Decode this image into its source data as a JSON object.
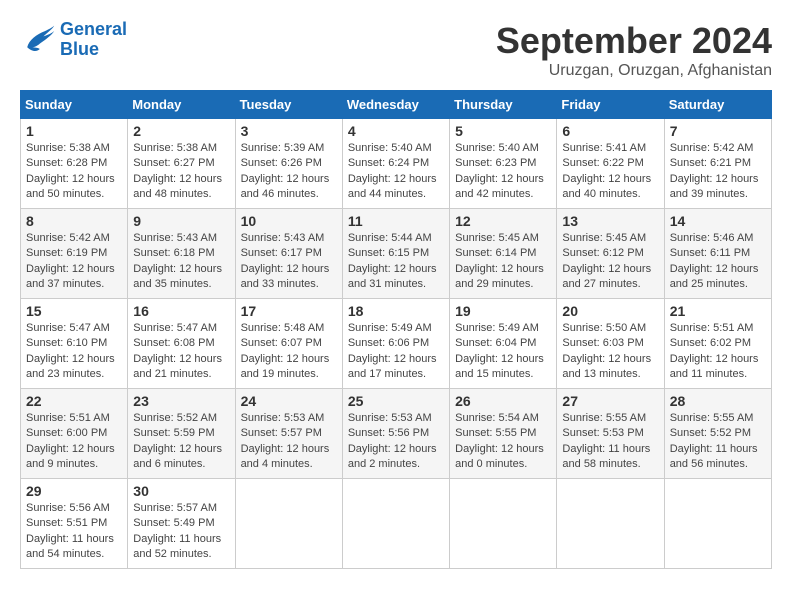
{
  "header": {
    "logo_line1": "General",
    "logo_line2": "Blue",
    "month": "September 2024",
    "location": "Uruzgan, Oruzgan, Afghanistan"
  },
  "weekdays": [
    "Sunday",
    "Monday",
    "Tuesday",
    "Wednesday",
    "Thursday",
    "Friday",
    "Saturday"
  ],
  "weeks": [
    [
      {
        "day": "1",
        "sunrise": "5:38 AM",
        "sunset": "6:28 PM",
        "daylight": "12 hours and 50 minutes."
      },
      {
        "day": "2",
        "sunrise": "5:38 AM",
        "sunset": "6:27 PM",
        "daylight": "12 hours and 48 minutes."
      },
      {
        "day": "3",
        "sunrise": "5:39 AM",
        "sunset": "6:26 PM",
        "daylight": "12 hours and 46 minutes."
      },
      {
        "day": "4",
        "sunrise": "5:40 AM",
        "sunset": "6:24 PM",
        "daylight": "12 hours and 44 minutes."
      },
      {
        "day": "5",
        "sunrise": "5:40 AM",
        "sunset": "6:23 PM",
        "daylight": "12 hours and 42 minutes."
      },
      {
        "day": "6",
        "sunrise": "5:41 AM",
        "sunset": "6:22 PM",
        "daylight": "12 hours and 40 minutes."
      },
      {
        "day": "7",
        "sunrise": "5:42 AM",
        "sunset": "6:21 PM",
        "daylight": "12 hours and 39 minutes."
      }
    ],
    [
      {
        "day": "8",
        "sunrise": "5:42 AM",
        "sunset": "6:19 PM",
        "daylight": "12 hours and 37 minutes."
      },
      {
        "day": "9",
        "sunrise": "5:43 AM",
        "sunset": "6:18 PM",
        "daylight": "12 hours and 35 minutes."
      },
      {
        "day": "10",
        "sunrise": "5:43 AM",
        "sunset": "6:17 PM",
        "daylight": "12 hours and 33 minutes."
      },
      {
        "day": "11",
        "sunrise": "5:44 AM",
        "sunset": "6:15 PM",
        "daylight": "12 hours and 31 minutes."
      },
      {
        "day": "12",
        "sunrise": "5:45 AM",
        "sunset": "6:14 PM",
        "daylight": "12 hours and 29 minutes."
      },
      {
        "day": "13",
        "sunrise": "5:45 AM",
        "sunset": "6:12 PM",
        "daylight": "12 hours and 27 minutes."
      },
      {
        "day": "14",
        "sunrise": "5:46 AM",
        "sunset": "6:11 PM",
        "daylight": "12 hours and 25 minutes."
      }
    ],
    [
      {
        "day": "15",
        "sunrise": "5:47 AM",
        "sunset": "6:10 PM",
        "daylight": "12 hours and 23 minutes."
      },
      {
        "day": "16",
        "sunrise": "5:47 AM",
        "sunset": "6:08 PM",
        "daylight": "12 hours and 21 minutes."
      },
      {
        "day": "17",
        "sunrise": "5:48 AM",
        "sunset": "6:07 PM",
        "daylight": "12 hours and 19 minutes."
      },
      {
        "day": "18",
        "sunrise": "5:49 AM",
        "sunset": "6:06 PM",
        "daylight": "12 hours and 17 minutes."
      },
      {
        "day": "19",
        "sunrise": "5:49 AM",
        "sunset": "6:04 PM",
        "daylight": "12 hours and 15 minutes."
      },
      {
        "day": "20",
        "sunrise": "5:50 AM",
        "sunset": "6:03 PM",
        "daylight": "12 hours and 13 minutes."
      },
      {
        "day": "21",
        "sunrise": "5:51 AM",
        "sunset": "6:02 PM",
        "daylight": "12 hours and 11 minutes."
      }
    ],
    [
      {
        "day": "22",
        "sunrise": "5:51 AM",
        "sunset": "6:00 PM",
        "daylight": "12 hours and 9 minutes."
      },
      {
        "day": "23",
        "sunrise": "5:52 AM",
        "sunset": "5:59 PM",
        "daylight": "12 hours and 6 minutes."
      },
      {
        "day": "24",
        "sunrise": "5:53 AM",
        "sunset": "5:57 PM",
        "daylight": "12 hours and 4 minutes."
      },
      {
        "day": "25",
        "sunrise": "5:53 AM",
        "sunset": "5:56 PM",
        "daylight": "12 hours and 2 minutes."
      },
      {
        "day": "26",
        "sunrise": "5:54 AM",
        "sunset": "5:55 PM",
        "daylight": "12 hours and 0 minutes."
      },
      {
        "day": "27",
        "sunrise": "5:55 AM",
        "sunset": "5:53 PM",
        "daylight": "11 hours and 58 minutes."
      },
      {
        "day": "28",
        "sunrise": "5:55 AM",
        "sunset": "5:52 PM",
        "daylight": "11 hours and 56 minutes."
      }
    ],
    [
      {
        "day": "29",
        "sunrise": "5:56 AM",
        "sunset": "5:51 PM",
        "daylight": "11 hours and 54 minutes."
      },
      {
        "day": "30",
        "sunrise": "5:57 AM",
        "sunset": "5:49 PM",
        "daylight": "11 hours and 52 minutes."
      },
      null,
      null,
      null,
      null,
      null
    ]
  ]
}
